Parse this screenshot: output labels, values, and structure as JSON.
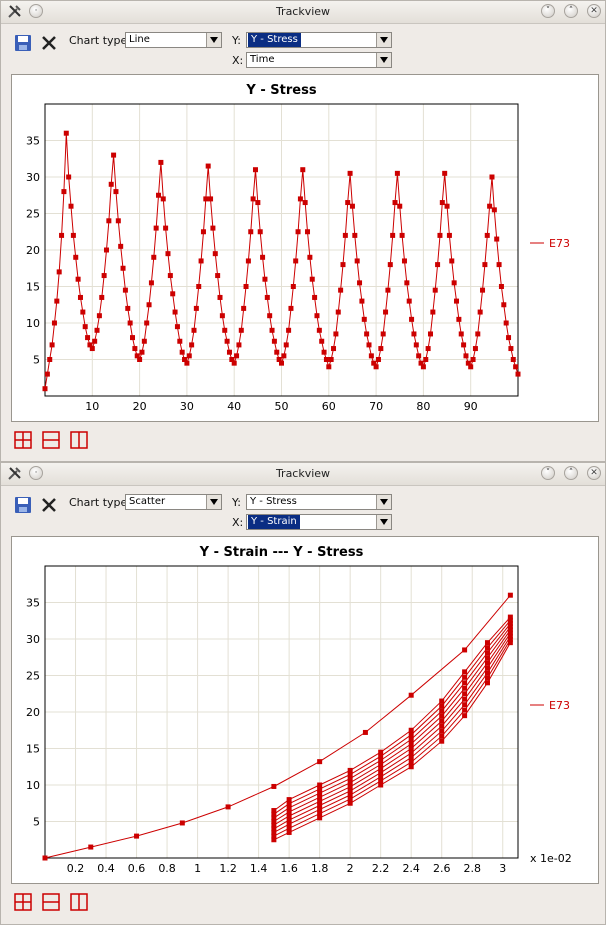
{
  "windows": [
    {
      "title": "Trackview",
      "chart_type_label": "Chart type:",
      "chart_type": "Line",
      "y_label": "Y:",
      "y_value": "Y - Stress",
      "x_label": "X:",
      "x_value": "Time",
      "selected": "y"
    },
    {
      "title": "Trackview",
      "chart_type_label": "Chart type:",
      "chart_type": "Scatter",
      "y_label": "Y:",
      "y_value": "Y - Stress",
      "x_label": "X:",
      "x_value": "Y - Strain",
      "selected": "x"
    }
  ],
  "icons": [
    "tools-icon",
    "minimize-icon",
    "save-icon",
    "close-icon",
    "crosshair-icon",
    "horizontal-range-icon",
    "vertical-range-icon"
  ],
  "colors": {
    "series": "#cc0000",
    "grid": "#e3e0d4",
    "selected": "#0a2d83"
  },
  "chart_data": [
    {
      "type": "line",
      "title": "Y - Stress",
      "xlim": [
        0,
        100
      ],
      "ylim": [
        0,
        40
      ],
      "x_ticks": [
        10,
        20,
        30,
        40,
        50,
        60,
        70,
        80,
        90
      ],
      "y_ticks": [
        5,
        10,
        15,
        20,
        25,
        30,
        35
      ],
      "grid": true,
      "legend_position": "right",
      "series": [
        {
          "name": "E73",
          "x": [
            0,
            0.5,
            1,
            1.5,
            2,
            2.5,
            3,
            3.5,
            4,
            4.5,
            5,
            5.5,
            6,
            6.5,
            7,
            7.5,
            8,
            8.5,
            9,
            9.5,
            10,
            10.5,
            11,
            11.5,
            12,
            12.5,
            13,
            13.5,
            14,
            14.5,
            15,
            15.5,
            16,
            16.5,
            17,
            17.5,
            18,
            18.5,
            19,
            19.5,
            20,
            20.5,
            21,
            21.5,
            22,
            22.5,
            23,
            23.5,
            24,
            24.5,
            25,
            25.5,
            26,
            26.5,
            27,
            27.5,
            28,
            28.5,
            29,
            29.5,
            30,
            30.5,
            31,
            31.5,
            32,
            32.5,
            33,
            33.5,
            34,
            34.5,
            35,
            35.5,
            36,
            36.5,
            37,
            37.5,
            38,
            38.5,
            39,
            39.5,
            40,
            40.5,
            41,
            41.5,
            42,
            42.5,
            43,
            43.5,
            44,
            44.5,
            45,
            45.5,
            46,
            46.5,
            47,
            47.5,
            48,
            48.5,
            49,
            49.5,
            50,
            50.5,
            51,
            51.5,
            52,
            52.5,
            53,
            53.5,
            54,
            54.5,
            55,
            55.5,
            56,
            56.5,
            57,
            57.5,
            58,
            58.5,
            59,
            59.5,
            60,
            60.5,
            61,
            61.5,
            62,
            62.5,
            63,
            63.5,
            64,
            64.5,
            65,
            65.5,
            66,
            66.5,
            67,
            67.5,
            68,
            68.5,
            69,
            69.5,
            70,
            70.5,
            71,
            71.5,
            72,
            72.5,
            73,
            73.5,
            74,
            74.5,
            75,
            75.5,
            76,
            76.5,
            77,
            77.5,
            78,
            78.5,
            79,
            79.5,
            80,
            80.5,
            81,
            81.5,
            82,
            82.5,
            83,
            83.5,
            84,
            84.5,
            85,
            85.5,
            86,
            86.5,
            87,
            87.5,
            88,
            88.5,
            89,
            89.5,
            90,
            90.5,
            91,
            91.5,
            92,
            92.5,
            93,
            93.5,
            94,
            94.5,
            95,
            95.5,
            96,
            96.5,
            97,
            97.5,
            98,
            98.5,
            99,
            99.5,
            100
          ],
          "y": [
            1,
            3,
            5,
            7,
            10,
            13,
            17,
            22,
            28,
            36,
            30,
            26,
            22,
            19,
            16,
            13.5,
            11.5,
            9.5,
            8,
            7,
            6.5,
            7.5,
            9,
            11,
            13.5,
            16.5,
            20,
            24,
            29,
            33,
            28,
            24,
            20.5,
            17.5,
            14.5,
            12,
            10,
            8,
            6.5,
            5.5,
            5,
            6,
            7.5,
            10,
            12.5,
            15.5,
            19,
            23,
            27.5,
            32,
            27,
            23,
            19.5,
            16.5,
            14,
            11.5,
            9.5,
            7.5,
            6,
            5,
            4.5,
            5.5,
            7,
            9,
            12,
            15,
            18.5,
            22.5,
            27,
            31.5,
            27,
            23,
            19.5,
            16.5,
            13.5,
            11,
            9,
            7.5,
            6,
            5,
            4.5,
            5.5,
            7,
            9,
            12,
            15,
            18.5,
            22.5,
            27,
            31,
            26.5,
            22.5,
            19,
            16,
            13.5,
            11,
            9,
            7.5,
            6,
            5,
            4.5,
            5.5,
            7,
            9,
            12,
            15,
            18.5,
            22.5,
            27,
            31,
            26.5,
            22.5,
            19,
            16,
            13.5,
            11,
            9,
            7.5,
            6,
            5,
            4,
            5,
            6.5,
            8.5,
            11.5,
            14.5,
            18,
            22,
            26.5,
            30.5,
            26,
            22,
            18.5,
            15.5,
            13,
            10.5,
            8.5,
            7,
            5.5,
            4.5,
            4,
            5,
            6.5,
            8.5,
            11.5,
            14.5,
            18,
            22,
            26.5,
            30.5,
            26,
            22,
            18.5,
            15.5,
            13,
            10.5,
            8.5,
            7,
            5.5,
            4.5,
            4,
            5,
            6.5,
            8.5,
            11.5,
            14.5,
            18,
            22,
            26.5,
            30.5,
            26,
            22,
            18.5,
            15.5,
            13,
            10.5,
            8.5,
            7,
            5.5,
            4.5,
            4,
            5,
            6.5,
            8.5,
            11.5,
            14.5,
            18,
            22,
            26,
            30,
            25.5,
            21.5,
            18,
            15,
            12.5,
            10,
            8,
            6.5,
            5,
            4,
            3
          ]
        }
      ]
    },
    {
      "type": "scatter",
      "title": "Y - Strain   ---   Y - Stress",
      "xlim": [
        0,
        0.031
      ],
      "ylim": [
        0,
        40
      ],
      "x_ticks": [
        0.2,
        0.4,
        0.6,
        0.8,
        1,
        1.2,
        1.4,
        1.6,
        1.8,
        2,
        2.2,
        2.4,
        2.6,
        2.8,
        3
      ],
      "x_scale_label": "x 1e-02",
      "y_ticks": [
        5,
        10,
        15,
        20,
        25,
        30,
        35
      ],
      "grid": true,
      "legend_position": "right",
      "series": [
        {
          "name": "E73",
          "loading": {
            "x": [
              0,
              0.003,
              0.006,
              0.009,
              0.012,
              0.015,
              0.018,
              0.021,
              0.024,
              0.0275,
              0.0305
            ],
            "y": [
              0,
              1.5,
              3,
              4.8,
              7,
              9.8,
              13.2,
              17.2,
              22.3,
              28.5,
              36
            ]
          },
          "cycles": {
            "x": [
              0.015,
              0.016,
              0.018,
              0.02,
              0.022,
              0.024,
              0.026,
              0.0275,
              0.029,
              0.0305
            ],
            "y_top": [
              6.5,
              8,
              10,
              12,
              14.5,
              17.5,
              21.5,
              25.5,
              29.5,
              33
            ],
            "y_bottom": [
              2.5,
              3.5,
              5.5,
              7.5,
              10,
              12.5,
              16,
              19.5,
              24,
              29.5
            ],
            "count": 9
          }
        }
      ]
    }
  ]
}
